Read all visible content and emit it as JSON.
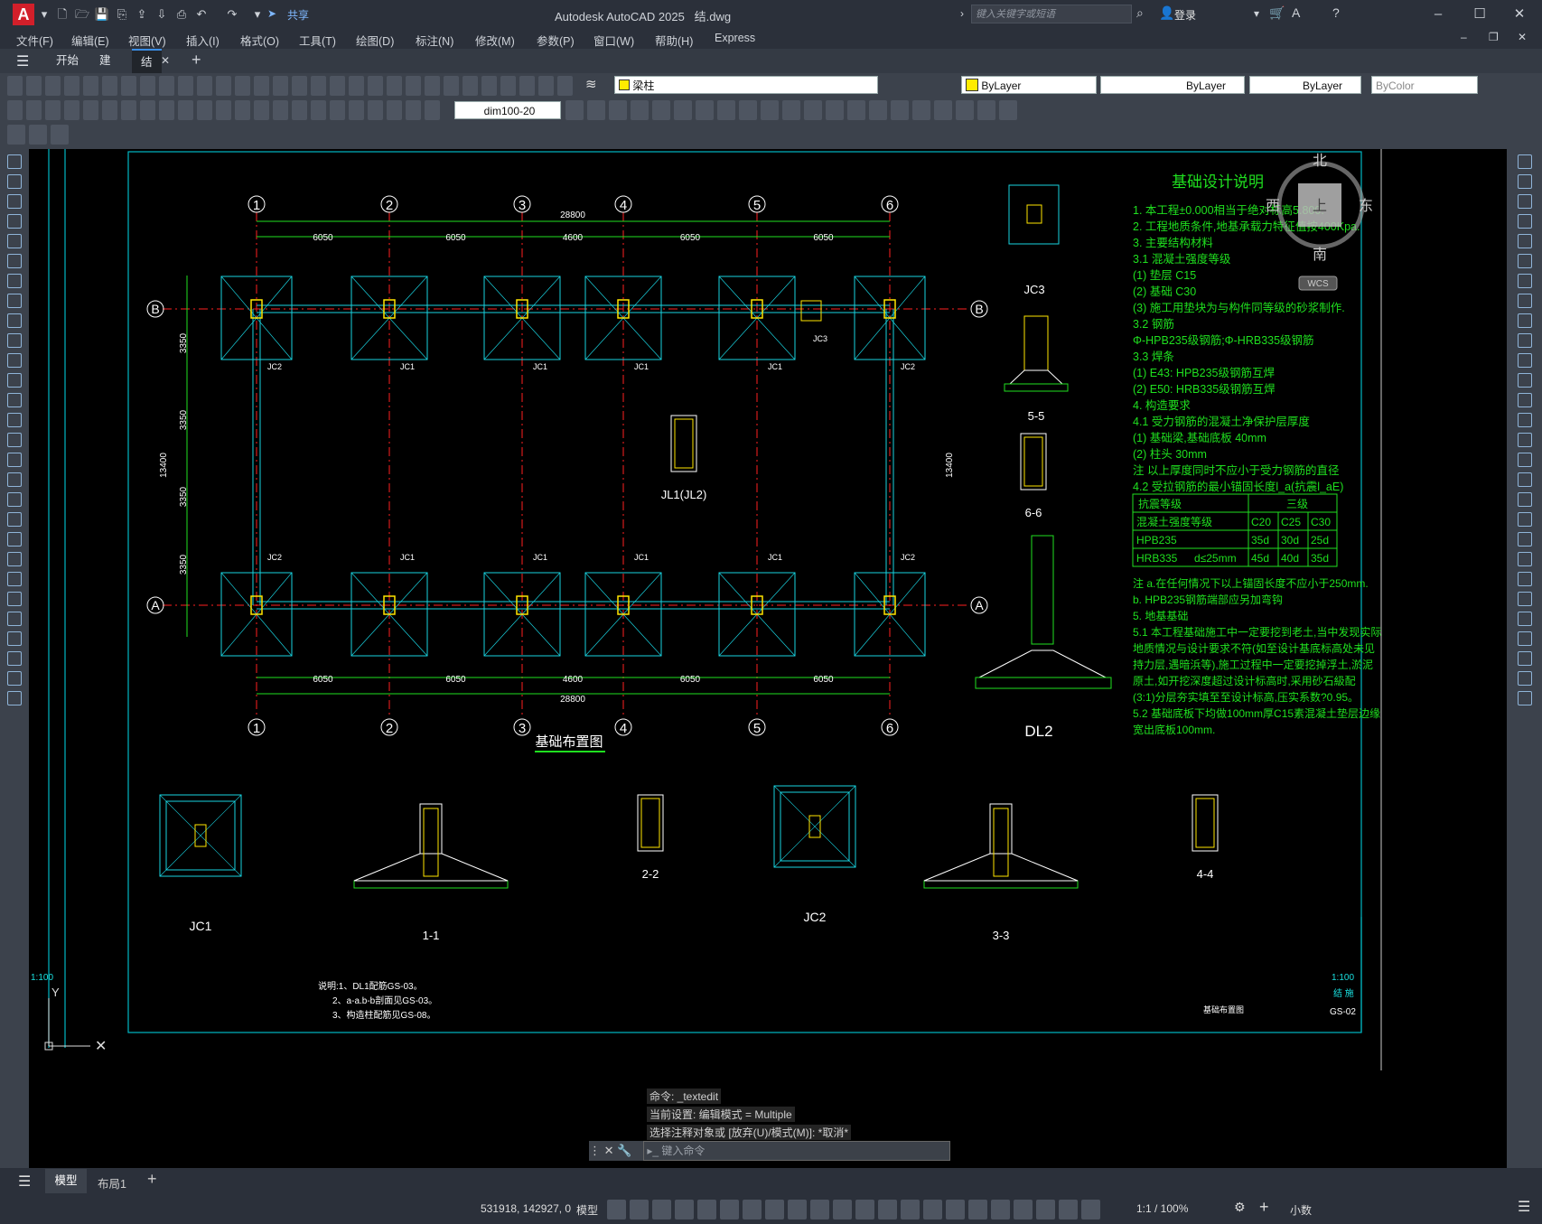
{
  "app": {
    "title": "Autodesk AutoCAD 2025",
    "filename": "结.dwg",
    "logo": "A"
  },
  "quick_access": {
    "share_label": "共享"
  },
  "search": {
    "placeholder": "键入关键字或短语"
  },
  "account": {
    "login_label": "登录"
  },
  "menus": [
    "文件(F)",
    "编辑(E)",
    "视图(V)",
    "插入(I)",
    "格式(O)",
    "工具(T)",
    "绘图(D)",
    "标注(N)",
    "修改(M)",
    "参数(P)",
    "窗口(W)",
    "帮助(H)",
    "Express"
  ],
  "tabs": {
    "start": "开始",
    "tab2": "建",
    "tab3": "结"
  },
  "toolbar": {
    "layer": "梁柱",
    "color": "ByLayer",
    "linetype": "ByLayer",
    "lineweight": "ByLayer",
    "plotstyle": "ByColor",
    "dimstyle": "dim100-20"
  },
  "viewcube": {
    "north": "北",
    "south": "南",
    "east": "东",
    "west": "西",
    "top": "上",
    "wcs": "WCS"
  },
  "command": {
    "history": [
      "命令: _textedit",
      "当前设置: 编辑模式 = Multiple",
      "选择注释对象或 [放弃(U)/模式(M)]: *取消*"
    ],
    "placeholder": "键入命令"
  },
  "layout_tabs": [
    "模型",
    "布局1"
  ],
  "status": {
    "coords": "531918, 142927, 0",
    "model": "模型",
    "scale": "1:1 / 100%",
    "units": "小数"
  },
  "drawing": {
    "plan_title": "基础布置图",
    "notes_title": "基础设计说明",
    "axes_cols": [
      "1",
      "2",
      "3",
      "4",
      "5",
      "6"
    ],
    "axes_rows": [
      "B",
      "A"
    ],
    "dims_top": [
      "6050",
      "6050",
      "4600",
      "6050",
      "6050"
    ],
    "total_dim": "28800",
    "total_height": "13400",
    "row_dims": [
      "3350",
      "3350",
      "3350",
      "3350"
    ],
    "notes": [
      "1. 本工程±0.000相当于绝对标高5.800.",
      "2. 工程地质条件,地基承载力特征值按400Kpa.",
      "3. 主要结构材料",
      "3.1 混凝土强度等级",
      "(1) 垫层   C15",
      "(2) 基础   C30",
      "(3) 施工用垫块为与构件同等级的砂浆制作.",
      "3.2 钢筋",
      "Φ-HPB235级钢筋;Φ-HRB335级钢筋",
      "3.3 焊条",
      "(1) E43: HPB235级钢筋互焊",
      "(2) E50: HRB335级钢筋互焊",
      "4. 构造要求",
      "4.1 受力钢筋的混凝土净保护层厚度",
      "(1) 基础梁,基础底板      40mm",
      "(2) 柱头                   30mm",
      "注 以上厚度同时不应小于受力钢筋的直径",
      "4.2 受拉钢筋的最小锚固长度l_a(抗震l_aE)"
    ],
    "anchor_table": {
      "header": [
        "抗震等级",
        "三级"
      ],
      "row1": [
        "混凝土强度等级",
        "C20",
        "C25",
        "C30"
      ],
      "row2": [
        "HPB235",
        "35d",
        "30d",
        "25d"
      ],
      "row3": [
        "HRB335",
        "d≤25mm",
        "45d",
        "40d",
        "35d"
      ]
    },
    "notes2": [
      "注  a.在任何情况下以上锚固长度不应小于250mm.",
      "b. HPB235钢筋端部应另加弯钩",
      "5. 地基基础",
      "5.1 本工程基础施工中一定要挖到老土,当中发现实际",
      "地质情况与设计要求不符(如至设计基底标高处未见",
      "持力层,遇暗浜等),施工过程中一定要挖掉浮土,淤泥",
      "原土,如开挖深度超过设计标高时,采用砂石級配",
      "(3:1)分层夯实填至至设计标高,压实系数?0.95。",
      "5.2 基础底板下均做100mm厚C15素混凝土垫层边缘",
      "宽出底板100mm."
    ],
    "detail_labels": [
      "JC1",
      "1-1",
      "2-2",
      "JC2",
      "3-3",
      "4-4",
      "JC3",
      "5-5",
      "6-6",
      "DL2",
      "JL1(JL2)"
    ],
    "footnotes": [
      "说明:1、DL1配筋GS-03。",
      "2、a-a.b-b剖面见GS-03。",
      "3、构造柱配筋见GS-08。"
    ],
    "frame_scale": "1:100",
    "frame_name": "基础布置图",
    "frame_sheet": "GS-02",
    "frame_dept": "结 施",
    "left_scale": "1:100"
  }
}
